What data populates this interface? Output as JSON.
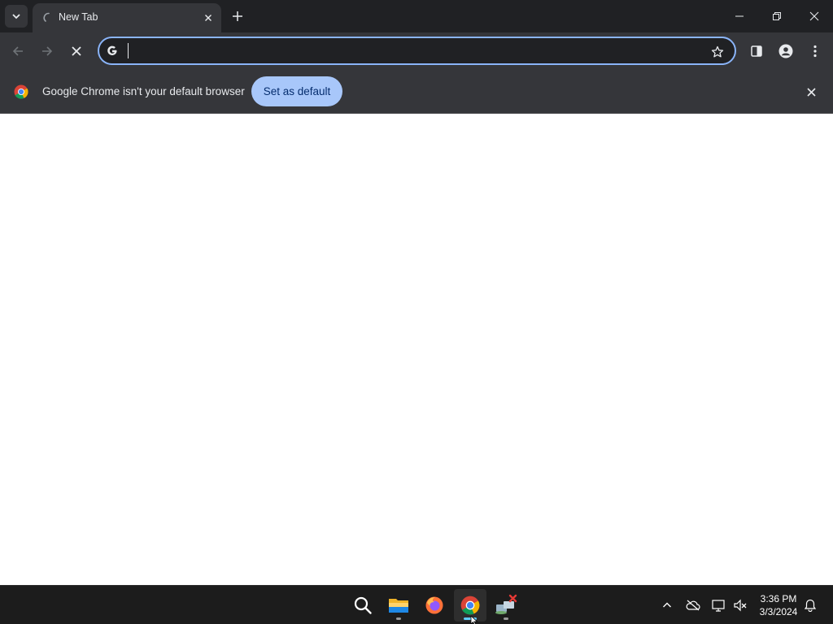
{
  "browser": {
    "tab": {
      "title": "New Tab"
    },
    "omnibox": {
      "value": "",
      "placeholder": ""
    },
    "infobar": {
      "message": "Google Chrome isn't your default browser",
      "button_label": "Set as default"
    }
  },
  "icons": {
    "tab_search": "chevron-down-icon",
    "tab_loading": "loading-spinner-icon",
    "tab_close": "close-icon",
    "new_tab": "plus-icon",
    "minimize": "minimize-icon",
    "restore": "restore-icon",
    "close_window": "close-icon",
    "back": "arrow-left-icon",
    "forward": "arrow-right-icon",
    "stop": "stop-icon",
    "omnibox_search": "google-g-icon",
    "bookmark": "star-icon",
    "side_panel": "side-panel-icon",
    "profile": "person-icon",
    "menu": "kebab-menu-icon",
    "chrome_logo": "chrome-logo-icon",
    "infobar_close": "close-icon"
  },
  "taskbar": {
    "apps": [
      {
        "name": "Search",
        "icon": "search-icon",
        "running": false
      },
      {
        "name": "File Explorer",
        "icon": "folder-icon",
        "running": true
      },
      {
        "name": "Firefox",
        "icon": "firefox-icon",
        "running": false
      },
      {
        "name": "Google Chrome",
        "icon": "chrome-icon",
        "running": true,
        "active": true
      },
      {
        "name": "Network app",
        "icon": "network-app-icon",
        "running": true
      }
    ],
    "tray": [
      "chevron-up-icon",
      "onedrive-offline-icon",
      "network-icon",
      "volume-muted-icon"
    ],
    "clock": {
      "time": "3:36 PM",
      "date": "3/3/2024"
    },
    "notifications_icon": "bell-icon"
  },
  "colors": {
    "titlebar": "#202124",
    "toolbar": "#35363a",
    "accent": "#8ab4f8",
    "button": "#a8c7fa",
    "taskbar": "#1c1c1c"
  }
}
